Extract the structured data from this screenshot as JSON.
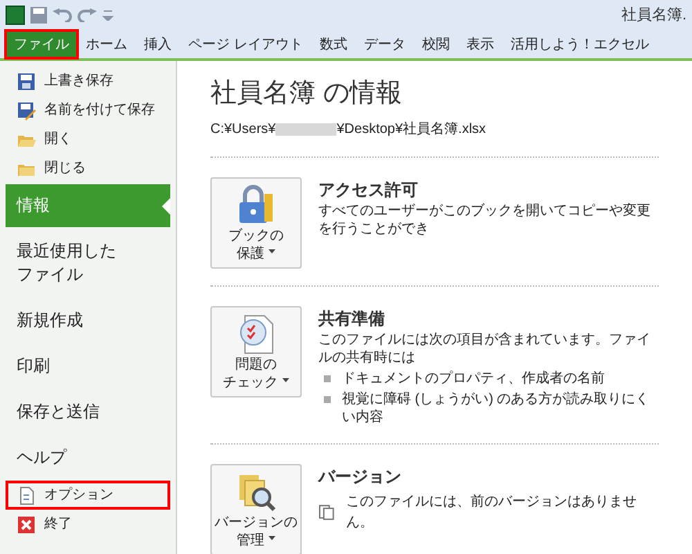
{
  "window": {
    "title": "社員名簿."
  },
  "tabs": [
    {
      "label": "ファイル",
      "selected": true,
      "highlighted": true
    },
    {
      "label": "ホーム",
      "selected": false,
      "highlighted": false
    },
    {
      "label": "挿入",
      "selected": false,
      "highlighted": false
    },
    {
      "label": "ページ レイアウト",
      "selected": false,
      "highlighted": false
    },
    {
      "label": "数式",
      "selected": false,
      "highlighted": false
    },
    {
      "label": "データ",
      "selected": false,
      "highlighted": false
    },
    {
      "label": "校閲",
      "selected": false,
      "highlighted": false
    },
    {
      "label": "表示",
      "selected": false,
      "highlighted": false
    },
    {
      "label": "活用しよう！エクセル",
      "selected": false,
      "highlighted": false
    }
  ],
  "sidebar": {
    "items": [
      {
        "kind": "command",
        "lines": [
          "上書き保存"
        ],
        "selected": false,
        "highlighted": false
      },
      {
        "kind": "command",
        "lines": [
          "名前を付けて保存"
        ],
        "selected": false,
        "highlighted": false
      },
      {
        "kind": "command",
        "lines": [
          "開く"
        ],
        "selected": false,
        "highlighted": false
      },
      {
        "kind": "command",
        "lines": [
          "閉じる"
        ],
        "selected": false,
        "highlighted": false
      },
      {
        "kind": "page",
        "lines": [
          "情報"
        ],
        "selected": true,
        "highlighted": false
      },
      {
        "kind": "page",
        "lines": [
          "最近使用した",
          "ファイル"
        ],
        "selected": false,
        "highlighted": false
      },
      {
        "kind": "page",
        "lines": [
          "新規作成"
        ],
        "selected": false,
        "highlighted": false
      },
      {
        "kind": "page",
        "lines": [
          "印刷"
        ],
        "selected": false,
        "highlighted": false
      },
      {
        "kind": "page",
        "lines": [
          "保存と送信"
        ],
        "selected": false,
        "highlighted": false
      },
      {
        "kind": "page",
        "lines": [
          "ヘルプ"
        ],
        "selected": false,
        "highlighted": false
      },
      {
        "kind": "command",
        "lines": [
          "オプション"
        ],
        "selected": false,
        "highlighted": true
      },
      {
        "kind": "command",
        "lines": [
          "終了"
        ],
        "selected": false,
        "highlighted": false
      }
    ]
  },
  "info": {
    "title": "社員名簿 の情報",
    "path_start": "C:¥Users¥",
    "path_end": "¥Desktop¥社員名簿.xlsx",
    "sections": [
      {
        "button": [
          "ブックの",
          "保護"
        ],
        "heading": "アクセス許可",
        "text": "すべてのユーザーがこのブックを開いてコピーや変更を行うことができ"
      },
      {
        "button": [
          "問題の",
          "チェック"
        ],
        "heading": "共有準備",
        "text": "このファイルには次の項目が含まれています。ファイルの共有時には",
        "bullets": [
          "ドキュメントのプロパティ、作成者の名前",
          "視覚に障碍 (しょうがい) のある方が読み取りにくい内容"
        ]
      },
      {
        "button": [
          "バージョンの",
          "管理"
        ],
        "heading": "バージョン",
        "note": "このファイルには、前のバージョンはありません。"
      }
    ]
  }
}
